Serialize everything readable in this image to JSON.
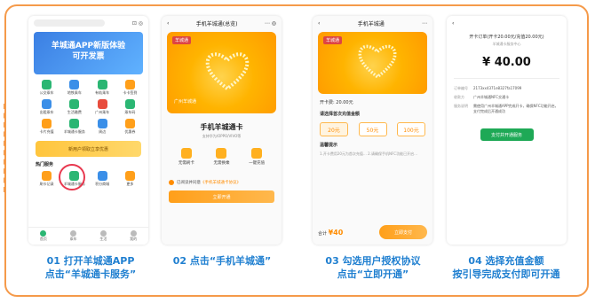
{
  "steps": [
    {
      "caption_line1": "01 打开羊城通APP",
      "caption_line2": "点击“羊城通卡服务”"
    },
    {
      "caption_line1": "02 点击“手机羊城通”",
      "caption_line2": ""
    },
    {
      "caption_line1": "03 勾选用户授权协议",
      "caption_line2": "点击“立即开通”"
    },
    {
      "caption_line1": "04 选择充值金额",
      "caption_line2": "按引导完成支付即可开通"
    }
  ],
  "phone1": {
    "banner": "羊城通APP新版体验\n可开发票",
    "grid": [
      "公交乘车",
      "地铁乘车",
      "有轨乘车",
      "卡卡签到",
      "出租乘车",
      "生活缴费",
      "广州乘车",
      "乘车码",
      "卡片充值",
      "羊城通卡服务",
      "周边",
      "优惠券"
    ],
    "yellow_bar": "新用户领取立享优惠",
    "hot_title": "热门服务",
    "hot_grid": [
      "刷卡记录",
      "羊城通卡服务",
      "积分商城",
      "更多"
    ],
    "tabs": [
      "首页",
      "乘车",
      "生活",
      "我的"
    ]
  },
  "phone2": {
    "nav_title": "手机羊城通(总览)",
    "card_logo": "羊城通",
    "card_bottom": "广州羊城通",
    "title": "手机羊城通卡",
    "subtitle": "支持华为/OPPO/VIVO等",
    "features": [
      "无需刷卡",
      "无需换乘",
      "一键充值"
    ],
    "agree_prefix": "已阅读并同意",
    "agree_link": "《手机羊城通卡协议》",
    "button": "立即开通"
  },
  "phone3": {
    "nav_title": "手机羊城通",
    "card_logo": "羊城通",
    "balance_label": "开卡费",
    "balance_value": "20.00元",
    "section_label": "请选择首次充值金额",
    "amounts": [
      "20元",
      "50元",
      "100元"
    ],
    "notice_title": "温馨提示",
    "notice": "1.开卡费用20元为首次充值…  2.请确保手机NFC功能已开启…",
    "total_label": "合计",
    "total_value": "¥40",
    "button": "立即支付"
  },
  "phone4": {
    "head": "开卡订单(开卡20.00元/充值20.00元)",
    "sub": "羊城通卡服务中心",
    "amount": "¥ 40.00",
    "details": [
      {
        "k": "订单编号",
        "v": "2173xx4371e8327fa17099"
      },
      {
        "k": "收款方",
        "v": "广州羊城通NFC交通卡"
      },
      {
        "k": "服务说明",
        "v": "需使用广州羊城通APP完成开卡，确保NFC功能开启，支付完成后开通成功"
      }
    ],
    "button": "支付并开通服务"
  }
}
